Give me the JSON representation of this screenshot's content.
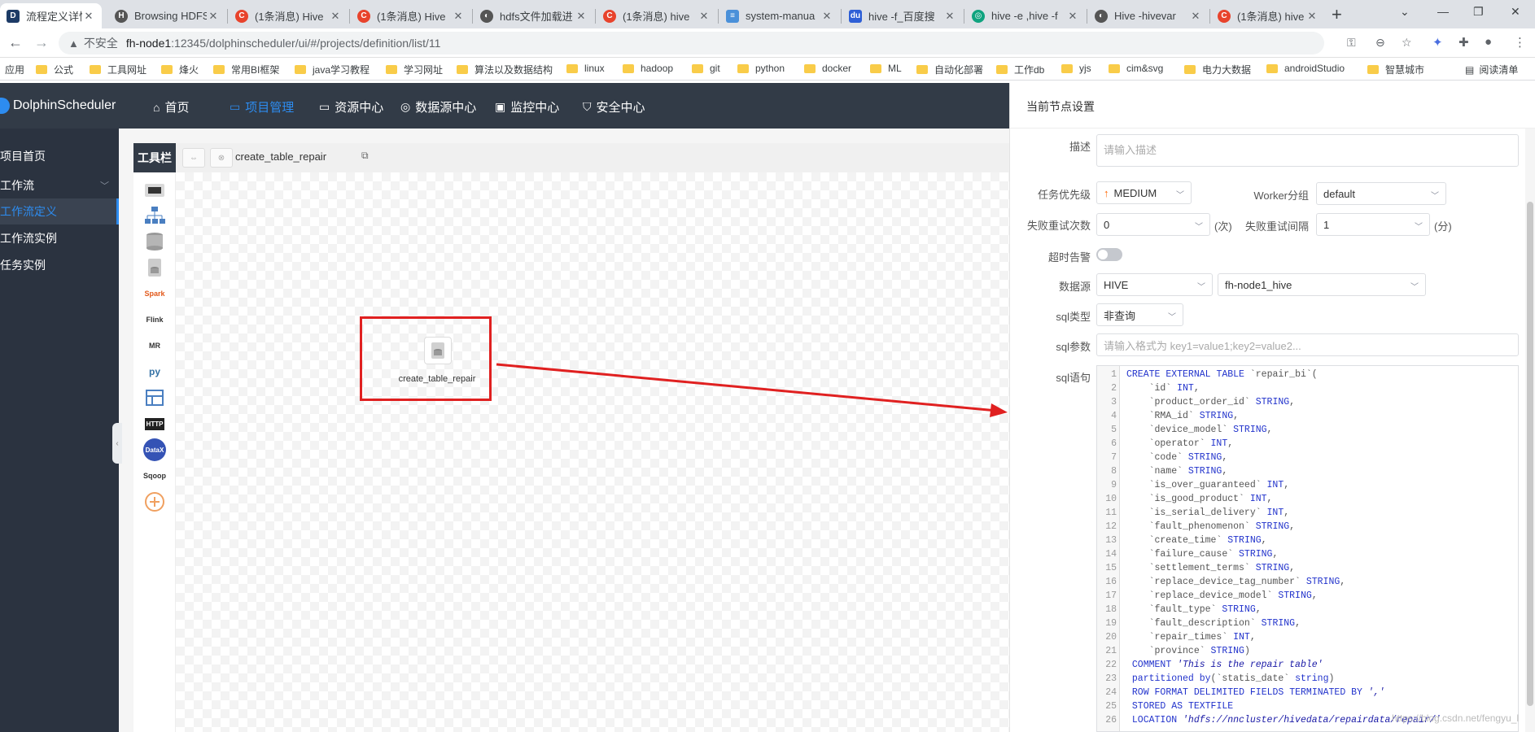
{
  "browser": {
    "tabs": [
      {
        "title": "流程定义详情 - ",
        "favicon": "dolphin-icon",
        "active": true
      },
      {
        "title": "Browsing HDFS",
        "favicon": "hadoop-icon"
      },
      {
        "title": "(1条消息) Hive",
        "favicon": "csdn-icon"
      },
      {
        "title": "(1条消息) Hive",
        "favicon": "csdn-icon"
      },
      {
        "title": "hdfs文件加载进",
        "favicon": "github-icon"
      },
      {
        "title": "(1条消息) hive",
        "favicon": "csdn-icon"
      },
      {
        "title": "system-manua",
        "favicon": "doc-icon"
      },
      {
        "title": "hive -f_百度搜",
        "favicon": "baidu-icon"
      },
      {
        "title": "hive -e ,hive -f",
        "favicon": "chatgpt-icon"
      },
      {
        "title": "Hive -hivevar",
        "favicon": "github-icon"
      },
      {
        "title": "(1条消息) hive",
        "favicon": "csdn-icon"
      }
    ],
    "address": {
      "security": "不安全",
      "host": "fh-node1",
      "path": ":12345/dolphinscheduler/ui/#/projects/definition/list/11"
    },
    "bookmarks": [
      "应用",
      "公式",
      "工具网址",
      "烽火",
      "常用BI框架",
      "java学习教程",
      "学习网址",
      "算法以及数据结构",
      "linux",
      "hadoop",
      "git",
      "python",
      "docker",
      "ML",
      "自动化部署",
      "工作db",
      "yjs",
      "cim&svg",
      "电力大数据",
      "androidStudio",
      "智慧城市"
    ],
    "reading_list": "阅读清单"
  },
  "app": {
    "name": "DolphinScheduler",
    "nav": [
      {
        "label": "首页",
        "icon": "home-icon"
      },
      {
        "label": "项目管理",
        "icon": "project-icon",
        "active": true
      },
      {
        "label": "资源中心",
        "icon": "folder-icon"
      },
      {
        "label": "数据源中心",
        "icon": "database-icon"
      },
      {
        "label": "监控中心",
        "icon": "monitor-icon"
      },
      {
        "label": "安全中心",
        "icon": "shield-icon"
      }
    ],
    "sidebar": [
      {
        "label": "项目首页"
      },
      {
        "label": "工作流",
        "expandable": true
      },
      {
        "label": "工作流定义",
        "active": true
      },
      {
        "label": "工作流实例"
      },
      {
        "label": "任务实例"
      }
    ]
  },
  "canvas": {
    "toolbar_label": "工具栏",
    "workflow_name": "create_table_repair",
    "node_label": "create_table_repair",
    "tools": [
      "shell-icon",
      "sub-process-icon",
      "procedure-icon",
      "sql-icon",
      "spark-icon",
      "flink-icon",
      "mr-icon",
      "python-icon",
      "dependent-icon",
      "http-icon",
      "datax-icon",
      "sqoop-icon",
      "conditions-icon"
    ]
  },
  "panel": {
    "title": "当前节点设置",
    "desc_label": "描述",
    "desc_placeholder": "请输入描述",
    "priority_label": "任务优先级",
    "priority": "MEDIUM",
    "worker_label": "Worker分组",
    "worker": "default",
    "retry_label": "失败重试次数",
    "retry_value": "0",
    "retry_unit": "(次)",
    "interval_label": "失败重试间隔",
    "interval_value": "1",
    "interval_unit": "(分)",
    "timeout_label": "超时告警",
    "datasource_label": "数据源",
    "datasource_type": "HIVE",
    "datasource_name": "fh-node1_hive",
    "sqltype_label": "sql类型",
    "sqltype": "非查询",
    "params_label": "sql参数",
    "params_placeholder": "请输入格式为 key1=value1;key2=value2...",
    "sql_label": "sql语句",
    "sql_lines": [
      "CREATE EXTERNAL TABLE `repair_bi`(",
      "    `id` INT,",
      "    `product_order_id` STRING,",
      "    `RMA_id` STRING,",
      "    `device_model` STRING,",
      "    `operator` INT,",
      "    `code` STRING,",
      "    `name` STRING,",
      "    `is_over_guaranteed` INT,",
      "    `is_good_product` INT,",
      "    `is_serial_delivery` INT,",
      "    `fault_phenomenon` STRING,",
      "    `create_time` STRING,",
      "    `failure_cause` STRING,",
      "    `settlement_terms` STRING,",
      "    `replace_device_tag_number` STRING,",
      "    `replace_device_model` STRING,",
      "    `fault_type` STRING,",
      "    `fault_description` STRING,",
      "    `repair_times` INT,",
      "    `province` STRING)",
      " COMMENT 'This is the repair table'",
      " partitioned by(`statis_date` string)",
      " ROW FORMAT DELIMITED FIELDS TERMINATED BY ','",
      " STORED AS TEXTFILE",
      " LOCATION 'hdfs://nncluster/hivedata/repairdata/repair/'"
    ]
  },
  "watermark": "https://blog.csdn.net/fengyu_l"
}
